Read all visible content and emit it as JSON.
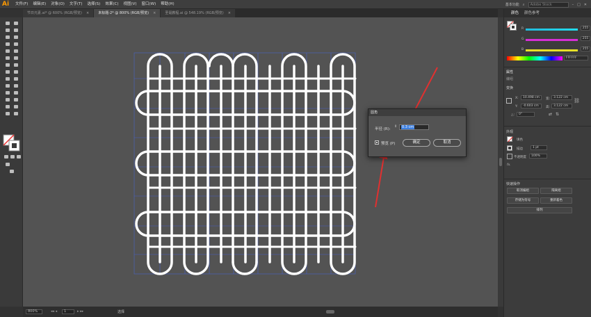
{
  "app": {
    "logo": "Ai"
  },
  "menus": [
    "文件(F)",
    "编辑(E)",
    "对象(O)",
    "文字(T)",
    "选择(S)",
    "效果(C)",
    "视图(V)",
    "窗口(W)",
    "帮助(H)"
  ],
  "topbar": {
    "workspace": "基本功能",
    "search_placeholder": "Adobe Stock"
  },
  "tabs": [
    {
      "label": "节日元素.ai* @ 600% (RGB/预览)",
      "close": "×"
    },
    {
      "label": "未标题-2* @ 800% (RGB/预览)",
      "close": "×"
    },
    {
      "label": "圣诞教程.ai @ 548.19% (RGB/预览)",
      "close": "×"
    }
  ],
  "status": {
    "zoom": "800%",
    "page": "1",
    "mode": "选择"
  },
  "dialog": {
    "title": "圆角",
    "radius_label": "半径 (R):",
    "radius_value": "0.3 cm",
    "preview_label": "预览 (P)",
    "ok_label": "确定",
    "cancel_label": "取消"
  },
  "panel": {
    "tabs": [
      "颜色",
      "颜色参考"
    ],
    "color": {
      "r_label": "R",
      "g_label": "G",
      "b_label": "B",
      "r_value": "255",
      "g_value": "255",
      "b_value": "255",
      "hex": "FFFFFF",
      "r_color": "#e64545",
      "g_color": "#2ecc40",
      "b_color": "#3b6cff"
    },
    "properties_title": "属性",
    "edit_label": "编组",
    "transform_label": "变换",
    "x_label": "X:",
    "x_value": "10.498 cm",
    "y_label": "Y:",
    "y_value": "-0.603 cm",
    "w_label": "宽:",
    "w_value": "3.122 cm",
    "h_label": "高:",
    "h_value": "3.122 cm",
    "angle_label": "△:",
    "angle_value": "0°",
    "appearance_label": "外观",
    "fill_label": "填色",
    "stroke_label": "描边",
    "stroke_value": "1 pt",
    "opacity_label": "不透明度",
    "opacity_value": "100%",
    "fx_label": "fx.",
    "quick_actions_label": "快速操作",
    "buttons": [
      "取消编组",
      "隔离组",
      "存储为符号",
      "重新着色",
      "排列"
    ]
  }
}
